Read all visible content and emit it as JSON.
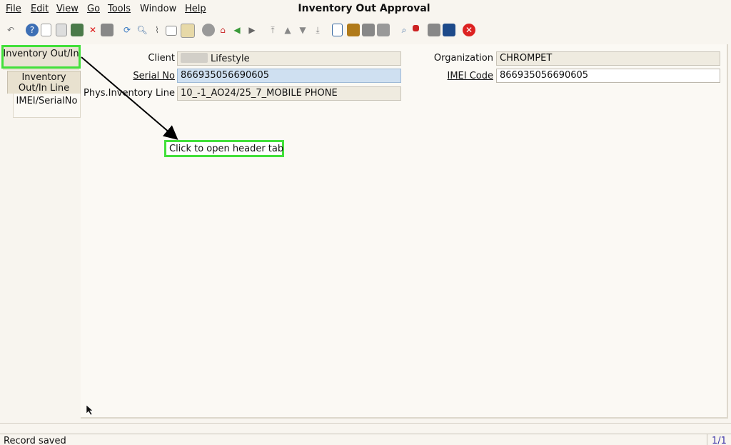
{
  "window": {
    "title": "Inventory Out Approval"
  },
  "menu": [
    {
      "label": "File"
    },
    {
      "label": "Edit"
    },
    {
      "label": "View"
    },
    {
      "label": "Go"
    },
    {
      "label": "Tools"
    },
    {
      "label": "Window"
    },
    {
      "label": "Help"
    }
  ],
  "toolbar": {
    "icons": [
      "undo-icon",
      "help-icon",
      "new-record-icon",
      "copy-record-icon",
      "save-icon",
      "delete-icon",
      "save-disk-icon",
      "refresh-icon",
      "find-icon",
      "attachment-icon",
      "chat-icon",
      "history-icon",
      "home-icon",
      "home-red-icon",
      "back-icon",
      "forward-icon",
      "first-icon",
      "previous-icon",
      "next-icon",
      "last-icon",
      "report-icon",
      "archive-icon",
      "print-preview-icon",
      "print-icon",
      "zoom-across-icon",
      "workflow-icon",
      "request-icon",
      "product-info-icon",
      "close-window-icon"
    ]
  },
  "tabs": [
    {
      "label": "Inventory Out/In"
    },
    {
      "label": "Inventory Out/In Line"
    },
    {
      "label": "IMEI/SerialNo"
    }
  ],
  "form": {
    "client_label": "Client",
    "client_value": "Lifestyle",
    "serial_label": "Serial No",
    "serial_value": "866935056690605",
    "phys_label": "Phys.Inventory Line",
    "phys_value": "10_-1_AO24/25_7_MOBILE PHONE",
    "org_label": "Organization",
    "org_value": "CHROMPET",
    "imei_label": "IMEI Code",
    "imei_value": "866935056690605"
  },
  "annotation": {
    "text": "Click to open header tab"
  },
  "status": {
    "message": "Record saved",
    "page": "1/1"
  },
  "colors": {
    "highlight": "#42e03a",
    "selected_field": "#cfe0f1",
    "page_indicator": "#3a33a8"
  }
}
